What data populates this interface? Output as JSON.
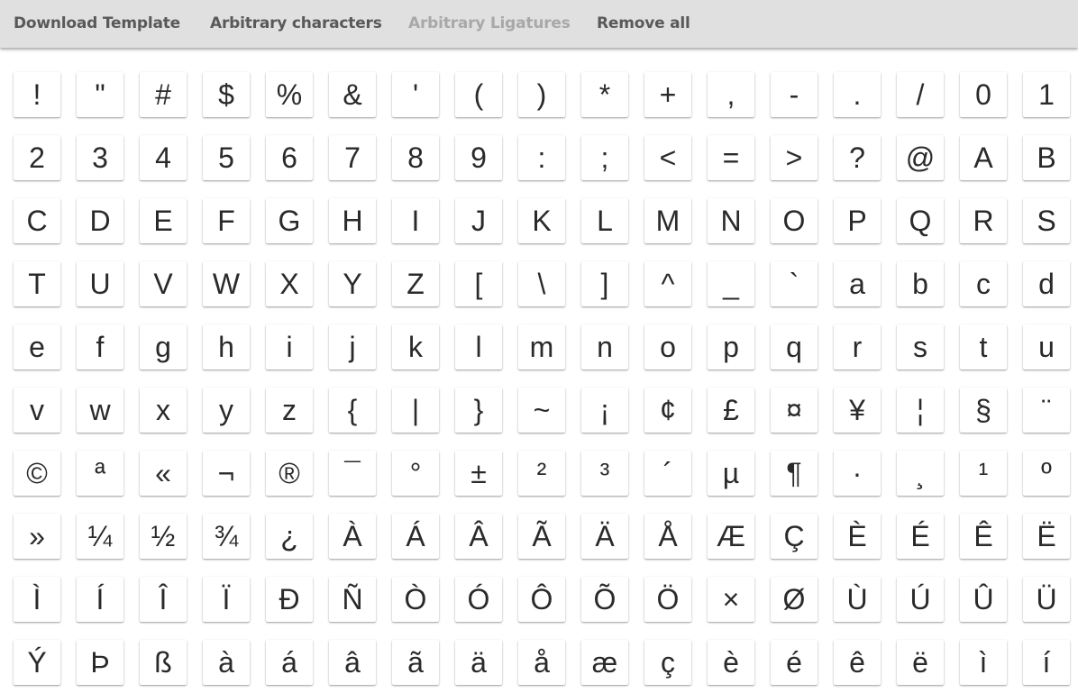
{
  "toolbar": {
    "download_template": "Download Template",
    "arbitrary_characters": "Arbitrary characters",
    "arbitrary_ligatures": "Arbitrary Ligatures",
    "remove_all": "Remove all"
  },
  "glyphs": [
    {
      "char": "!",
      "name": "exclam"
    },
    {
      "char": "\"",
      "name": "quotedbl"
    },
    {
      "char": "#",
      "name": "numbersign"
    },
    {
      "char": "$",
      "name": "dollar"
    },
    {
      "char": "%",
      "name": "percent"
    },
    {
      "char": "&",
      "name": "ampersand"
    },
    {
      "char": "'",
      "name": "quotesingle"
    },
    {
      "char": "(",
      "name": "parenleft"
    },
    {
      "char": ")",
      "name": "parenright"
    },
    {
      "char": "*",
      "name": "asterisk"
    },
    {
      "char": "+",
      "name": "plus"
    },
    {
      "char": ",",
      "name": "comma"
    },
    {
      "char": "-",
      "name": "hyphen"
    },
    {
      "char": ".",
      "name": "period"
    },
    {
      "char": "/",
      "name": "slash"
    },
    {
      "char": "0",
      "name": "zero"
    },
    {
      "char": "1",
      "name": "one"
    },
    {
      "char": "2",
      "name": "two"
    },
    {
      "char": "3",
      "name": "three"
    },
    {
      "char": "4",
      "name": "four"
    },
    {
      "char": "5",
      "name": "five"
    },
    {
      "char": "6",
      "name": "six"
    },
    {
      "char": "7",
      "name": "seven"
    },
    {
      "char": "8",
      "name": "eight"
    },
    {
      "char": "9",
      "name": "nine"
    },
    {
      "char": ":",
      "name": "colon"
    },
    {
      "char": ";",
      "name": "semicolon"
    },
    {
      "char": "<",
      "name": "less"
    },
    {
      "char": "=",
      "name": "equal"
    },
    {
      "char": ">",
      "name": "greater"
    },
    {
      "char": "?",
      "name": "question"
    },
    {
      "char": "@",
      "name": "at"
    },
    {
      "char": "A",
      "name": "A"
    },
    {
      "char": "B",
      "name": "B"
    },
    {
      "char": "C",
      "name": "C"
    },
    {
      "char": "D",
      "name": "D"
    },
    {
      "char": "E",
      "name": "E"
    },
    {
      "char": "F",
      "name": "F"
    },
    {
      "char": "G",
      "name": "G"
    },
    {
      "char": "H",
      "name": "H"
    },
    {
      "char": "I",
      "name": "I"
    },
    {
      "char": "J",
      "name": "J"
    },
    {
      "char": "K",
      "name": "K"
    },
    {
      "char": "L",
      "name": "L"
    },
    {
      "char": "M",
      "name": "M"
    },
    {
      "char": "N",
      "name": "N"
    },
    {
      "char": "O",
      "name": "O"
    },
    {
      "char": "P",
      "name": "P"
    },
    {
      "char": "Q",
      "name": "Q"
    },
    {
      "char": "R",
      "name": "R"
    },
    {
      "char": "S",
      "name": "S"
    },
    {
      "char": "T",
      "name": "T"
    },
    {
      "char": "U",
      "name": "U"
    },
    {
      "char": "V",
      "name": "V"
    },
    {
      "char": "W",
      "name": "W"
    },
    {
      "char": "X",
      "name": "X"
    },
    {
      "char": "Y",
      "name": "Y"
    },
    {
      "char": "Z",
      "name": "Z"
    },
    {
      "char": "[",
      "name": "bracketleft"
    },
    {
      "char": "\\",
      "name": "backslash"
    },
    {
      "char": "]",
      "name": "bracketright"
    },
    {
      "char": "^",
      "name": "asciicircum"
    },
    {
      "char": "_",
      "name": "underscore"
    },
    {
      "char": "`",
      "name": "grave"
    },
    {
      "char": "a",
      "name": "a"
    },
    {
      "char": "b",
      "name": "b"
    },
    {
      "char": "c",
      "name": "c"
    },
    {
      "char": "d",
      "name": "d"
    },
    {
      "char": "e",
      "name": "e"
    },
    {
      "char": "f",
      "name": "f"
    },
    {
      "char": "g",
      "name": "g"
    },
    {
      "char": "h",
      "name": "h"
    },
    {
      "char": "i",
      "name": "i"
    },
    {
      "char": "j",
      "name": "j"
    },
    {
      "char": "k",
      "name": "k"
    },
    {
      "char": "l",
      "name": "l"
    },
    {
      "char": "m",
      "name": "m"
    },
    {
      "char": "n",
      "name": "n"
    },
    {
      "char": "o",
      "name": "o"
    },
    {
      "char": "p",
      "name": "p"
    },
    {
      "char": "q",
      "name": "q"
    },
    {
      "char": "r",
      "name": "r"
    },
    {
      "char": "s",
      "name": "s"
    },
    {
      "char": "t",
      "name": "t"
    },
    {
      "char": "u",
      "name": "u"
    },
    {
      "char": "v",
      "name": "v"
    },
    {
      "char": "w",
      "name": "w"
    },
    {
      "char": "x",
      "name": "x"
    },
    {
      "char": "y",
      "name": "y"
    },
    {
      "char": "z",
      "name": "z"
    },
    {
      "char": "{",
      "name": "braceleft"
    },
    {
      "char": "|",
      "name": "bar"
    },
    {
      "char": "}",
      "name": "braceright"
    },
    {
      "char": "~",
      "name": "asciitilde"
    },
    {
      "char": "¡",
      "name": "exclamdown"
    },
    {
      "char": "¢",
      "name": "cent"
    },
    {
      "char": "£",
      "name": "sterling"
    },
    {
      "char": "¤",
      "name": "currency"
    },
    {
      "char": "¥",
      "name": "yen"
    },
    {
      "char": "¦",
      "name": "brokenbar"
    },
    {
      "char": "§",
      "name": "section"
    },
    {
      "char": "¨",
      "name": "dieresis"
    },
    {
      "char": "©",
      "name": "copyright"
    },
    {
      "char": "ª",
      "name": "ordfeminine"
    },
    {
      "char": "«",
      "name": "guillemotleft"
    },
    {
      "char": "¬",
      "name": "logicalnot"
    },
    {
      "char": "®",
      "name": "registered"
    },
    {
      "char": "¯",
      "name": "macron"
    },
    {
      "char": "°",
      "name": "degree"
    },
    {
      "char": "±",
      "name": "plusminus"
    },
    {
      "char": "²",
      "name": "twosuperior"
    },
    {
      "char": "³",
      "name": "threesuperior"
    },
    {
      "char": "´",
      "name": "acute"
    },
    {
      "char": "µ",
      "name": "mu"
    },
    {
      "char": "¶",
      "name": "paragraph"
    },
    {
      "char": "·",
      "name": "periodcentered"
    },
    {
      "char": "¸",
      "name": "cedilla"
    },
    {
      "char": "¹",
      "name": "onesuperior"
    },
    {
      "char": "º",
      "name": "ordmasculine"
    },
    {
      "char": "»",
      "name": "guillemotright"
    },
    {
      "char": "¼",
      "name": "onequarter"
    },
    {
      "char": "½",
      "name": "onehalf"
    },
    {
      "char": "¾",
      "name": "threequarters"
    },
    {
      "char": "¿",
      "name": "questiondown"
    },
    {
      "char": "À",
      "name": "Agrave"
    },
    {
      "char": "Á",
      "name": "Aacute"
    },
    {
      "char": "Â",
      "name": "Acircumflex"
    },
    {
      "char": "Ã",
      "name": "Atilde"
    },
    {
      "char": "Ä",
      "name": "Adieresis"
    },
    {
      "char": "Å",
      "name": "Aring"
    },
    {
      "char": "Æ",
      "name": "AE"
    },
    {
      "char": "Ç",
      "name": "Ccedilla"
    },
    {
      "char": "È",
      "name": "Egrave"
    },
    {
      "char": "É",
      "name": "Eacute"
    },
    {
      "char": "Ê",
      "name": "Ecircumflex"
    },
    {
      "char": "Ë",
      "name": "Edieresis"
    },
    {
      "char": "Ì",
      "name": "Igrave"
    },
    {
      "char": "Í",
      "name": "Iacute"
    },
    {
      "char": "Î",
      "name": "Icircumflex"
    },
    {
      "char": "Ï",
      "name": "Idieresis"
    },
    {
      "char": "Ð",
      "name": "Eth"
    },
    {
      "char": "Ñ",
      "name": "Ntilde"
    },
    {
      "char": "Ò",
      "name": "Ograve"
    },
    {
      "char": "Ó",
      "name": "Oacute"
    },
    {
      "char": "Ô",
      "name": "Ocircumflex"
    },
    {
      "char": "Õ",
      "name": "Otilde"
    },
    {
      "char": "Ö",
      "name": "Odieresis"
    },
    {
      "char": "×",
      "name": "multiply"
    },
    {
      "char": "Ø",
      "name": "Oslash"
    },
    {
      "char": "Ù",
      "name": "Ugrave"
    },
    {
      "char": "Ú",
      "name": "Uacute"
    },
    {
      "char": "Û",
      "name": "Ucircumflex"
    },
    {
      "char": "Ü",
      "name": "Udieresis"
    },
    {
      "char": "Ý",
      "name": "Yacute"
    },
    {
      "char": "Þ",
      "name": "Thorn"
    },
    {
      "char": "ß",
      "name": "germandbls"
    },
    {
      "char": "à",
      "name": "agrave"
    },
    {
      "char": "á",
      "name": "aacute"
    },
    {
      "char": "â",
      "name": "acircumflex"
    },
    {
      "char": "ã",
      "name": "atilde"
    },
    {
      "char": "ä",
      "name": "adieresis"
    },
    {
      "char": "å",
      "name": "aring"
    },
    {
      "char": "æ",
      "name": "ae"
    },
    {
      "char": "ç",
      "name": "ccedilla"
    },
    {
      "char": "è",
      "name": "egrave"
    },
    {
      "char": "é",
      "name": "eacute"
    },
    {
      "char": "ê",
      "name": "ecircumflex"
    },
    {
      "char": "ë",
      "name": "edieresis"
    },
    {
      "char": "ì",
      "name": "igrave"
    },
    {
      "char": "í",
      "name": "iacute"
    }
  ]
}
